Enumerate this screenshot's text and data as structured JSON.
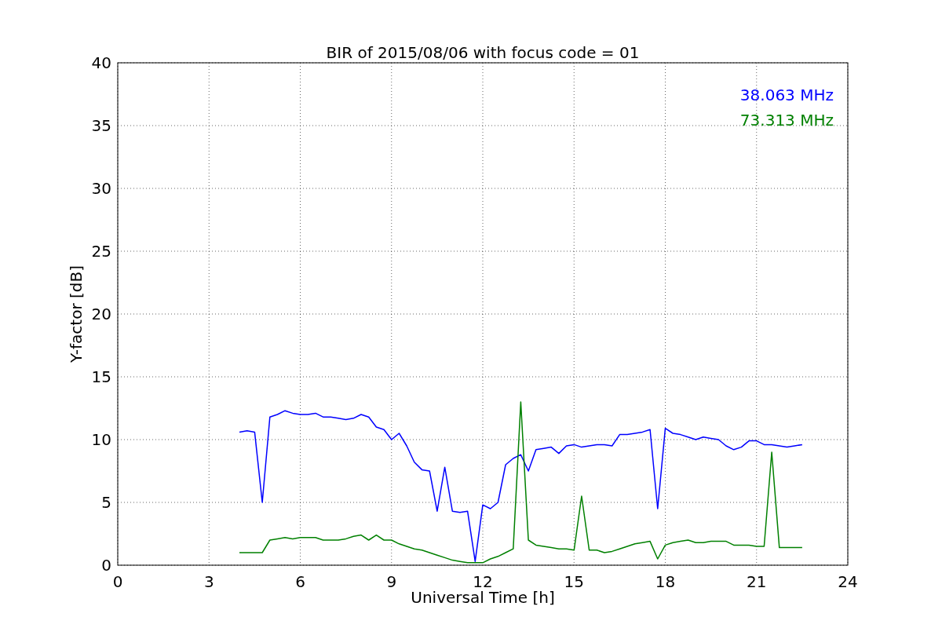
{
  "chart_data": {
    "type": "line",
    "title": "BIR of 2015/08/06 with focus code = 01",
    "xlabel": "Universal Time [h]",
    "ylabel": "Y-factor [dB]",
    "grid": true,
    "xlim": [
      0,
      24
    ],
    "ylim": [
      0,
      40
    ],
    "xticks": [
      0,
      3,
      6,
      9,
      12,
      15,
      18,
      21,
      24
    ],
    "yticks": [
      0,
      5,
      10,
      15,
      20,
      25,
      30,
      35,
      40
    ],
    "x": [
      4,
      4.25,
      4.5,
      4.75,
      5,
      5.25,
      5.5,
      5.75,
      6,
      6.25,
      6.5,
      6.75,
      7,
      7.25,
      7.5,
      7.75,
      8,
      8.25,
      8.5,
      8.75,
      9,
      9.25,
      9.5,
      9.75,
      10,
      10.25,
      10.5,
      10.75,
      11,
      11.25,
      11.5,
      11.75,
      12,
      12.25,
      12.5,
      12.75,
      13,
      13.25,
      13.5,
      13.75,
      14,
      14.25,
      14.5,
      14.75,
      15,
      15.25,
      15.5,
      15.75,
      16,
      16.25,
      16.5,
      16.75,
      17,
      17.25,
      17.5,
      17.75,
      18,
      18.25,
      18.5,
      18.75,
      19,
      19.25,
      19.5,
      19.75,
      20,
      20.25,
      20.5,
      20.75,
      21,
      21.25,
      21.5,
      21.75,
      22,
      22.25,
      22.5
    ],
    "series": [
      {
        "name": "38.063 MHz",
        "color": "#0000ff",
        "values": [
          10.6,
          10.7,
          10.6,
          5.0,
          11.8,
          12.0,
          12.3,
          12.1,
          12.0,
          12.0,
          12.1,
          11.8,
          11.8,
          11.7,
          11.6,
          11.7,
          12.0,
          11.8,
          11.0,
          10.8,
          10.0,
          10.5,
          9.5,
          8.2,
          7.6,
          7.5,
          4.3,
          7.8,
          4.3,
          4.2,
          4.3,
          0.3,
          4.8,
          4.5,
          5.0,
          8.0,
          8.5,
          8.8,
          7.5,
          9.2,
          9.3,
          9.4,
          8.9,
          9.5,
          9.6,
          9.4,
          9.5,
          9.6,
          9.6,
          9.5,
          10.4,
          10.4,
          10.5,
          10.6,
          10.8,
          4.5,
          10.9,
          10.5,
          10.4,
          10.2,
          10.0,
          10.2,
          10.1,
          10.0,
          9.5,
          9.2,
          9.4,
          9.9,
          9.9,
          9.6,
          9.6,
          9.5,
          9.4,
          9.5,
          9.6
        ]
      },
      {
        "name": "73.313 MHz",
        "color": "#008000",
        "values": [
          1.0,
          1.0,
          1.0,
          1.0,
          2.0,
          2.1,
          2.2,
          2.1,
          2.2,
          2.2,
          2.2,
          2.0,
          2.0,
          2.0,
          2.1,
          2.3,
          2.4,
          2.0,
          2.4,
          2.0,
          2.0,
          1.7,
          1.5,
          1.3,
          1.2,
          1.0,
          0.8,
          0.6,
          0.4,
          0.3,
          0.2,
          0.2,
          0.2,
          0.5,
          0.7,
          1.0,
          1.3,
          13.0,
          2.0,
          1.6,
          1.5,
          1.4,
          1.3,
          1.3,
          1.2,
          5.5,
          1.2,
          1.2,
          1.0,
          1.1,
          1.3,
          1.5,
          1.7,
          1.8,
          1.9,
          0.5,
          1.6,
          1.8,
          1.9,
          2.0,
          1.8,
          1.8,
          1.9,
          1.9,
          1.9,
          1.6,
          1.6,
          1.6,
          1.5,
          1.5,
          9.0,
          1.4,
          1.4,
          1.4,
          1.4
        ]
      }
    ]
  }
}
